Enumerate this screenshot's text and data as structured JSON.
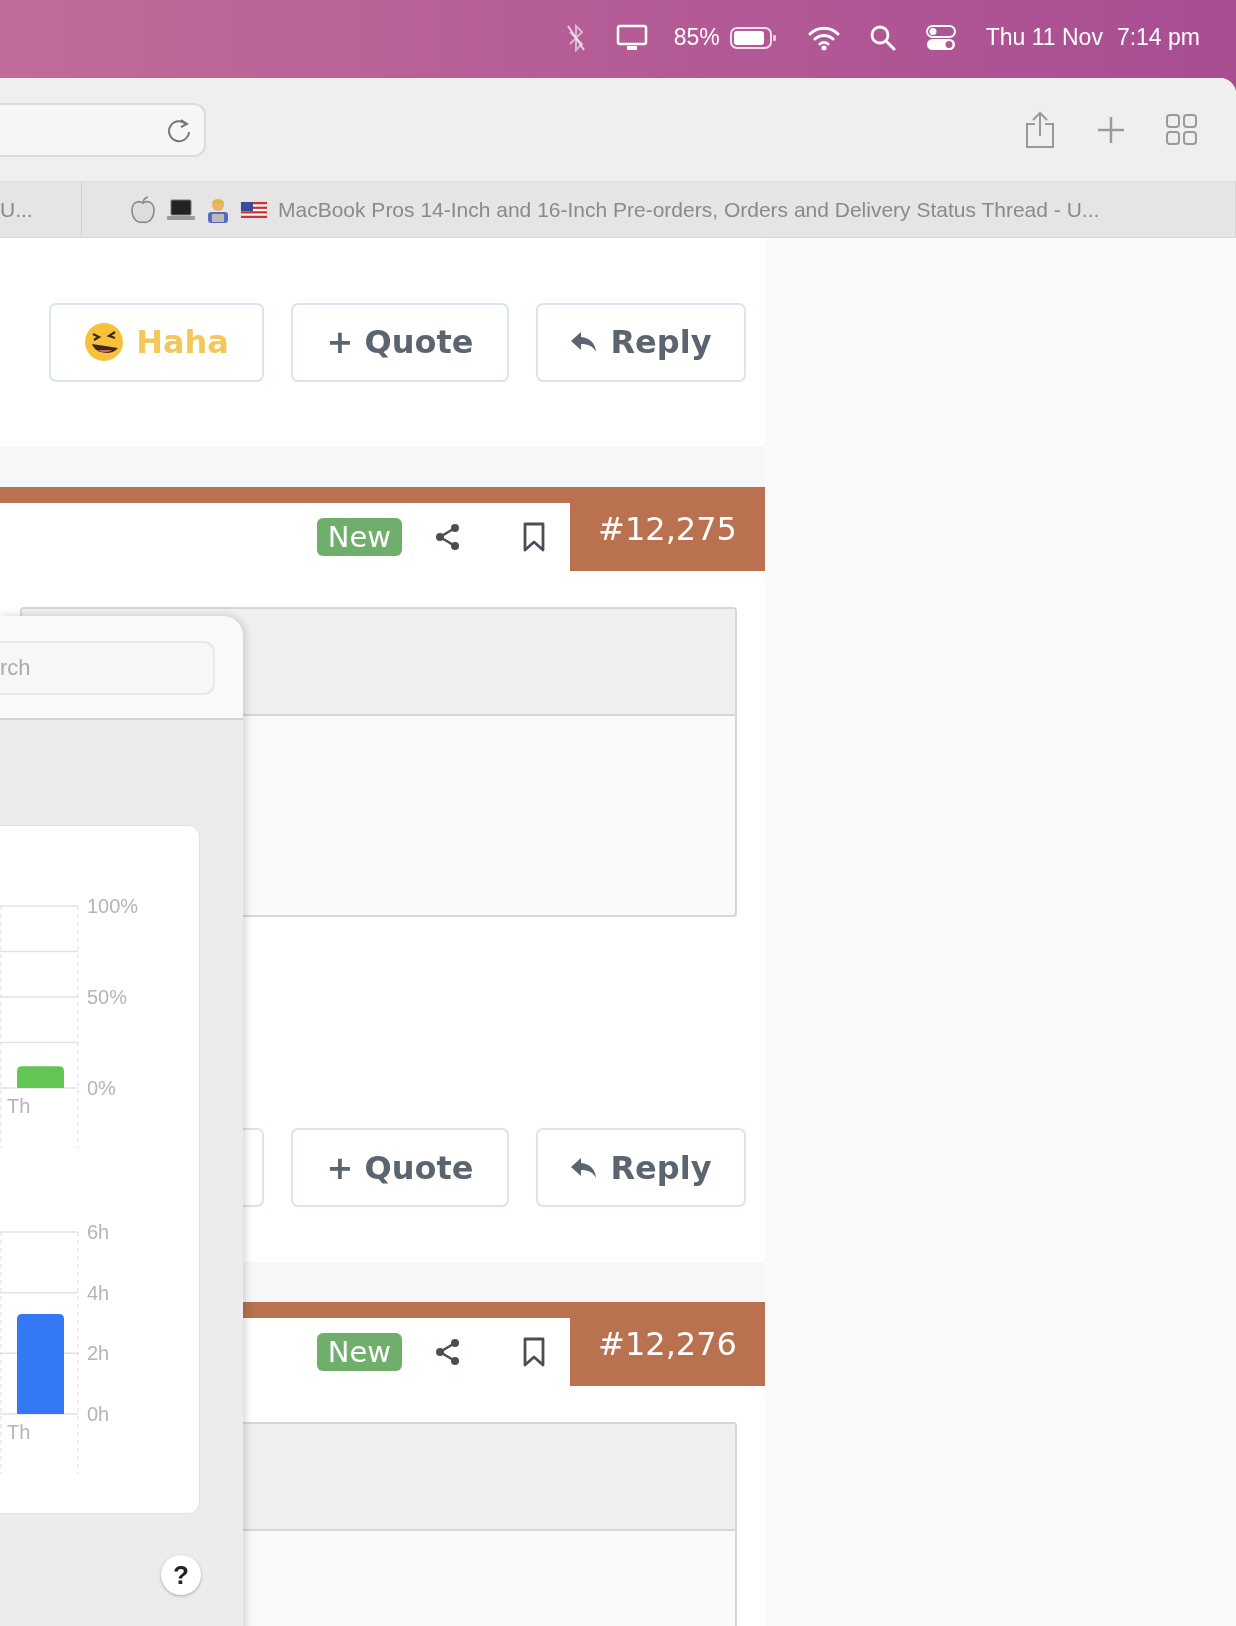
{
  "menu_bar": {
    "battery_percent": "85%",
    "date": "Thu 11 Nov",
    "time": "7:14 pm"
  },
  "browser": {
    "tabs": [
      {
        "title": "U..."
      },
      {
        "title": "MacBook Pros 14-Inch and 16-Inch Pre-orders, Orders and Delivery Status Thread - U..."
      }
    ]
  },
  "thread": [
    {
      "kind": "footer",
      "buttons": [
        {
          "kind": "reaction",
          "label": "Haha"
        },
        {
          "kind": "quote",
          "label": "+ Quote"
        },
        {
          "kind": "reply",
          "label": "Reply"
        }
      ]
    },
    {
      "kind": "post",
      "badge": "New",
      "number": "#12,275"
    },
    {
      "kind": "footer",
      "buttons": [
        {
          "kind": "reaction"
        },
        {
          "kind": "quote",
          "label": "+ Quote"
        },
        {
          "kind": "reply",
          "label": "Reply"
        }
      ]
    },
    {
      "kind": "post",
      "badge": "New",
      "number": "#12,276"
    }
  ],
  "panel": {
    "search": {
      "placeholder": "rch"
    },
    "charts": [
      {
        "chart_data": {
          "type": "bar",
          "categories": [
            "Th"
          ],
          "series": [
            {
              "color": "#62c554",
              "values": [
                12
              ]
            }
          ],
          "ylim": [
            0,
            100
          ],
          "yticks": [
            {
              "value": 100,
              "label": "100%"
            },
            {
              "value": 50,
              "label": "50%"
            },
            {
              "value": 0,
              "label": "0%"
            }
          ]
        }
      },
      {
        "chart_data": {
          "type": "bar",
          "categories": [
            "Th"
          ],
          "series": [
            {
              "color": "#3478f6",
              "values": [
                3.3
              ]
            }
          ],
          "ylim": [
            0,
            6
          ],
          "yticks": [
            {
              "value": 6,
              "label": "6h"
            },
            {
              "value": 4,
              "label": "4h"
            },
            {
              "value": 2,
              "label": "2h"
            },
            {
              "value": 0,
              "label": "0h"
            }
          ]
        }
      }
    ],
    "help": "?"
  }
}
